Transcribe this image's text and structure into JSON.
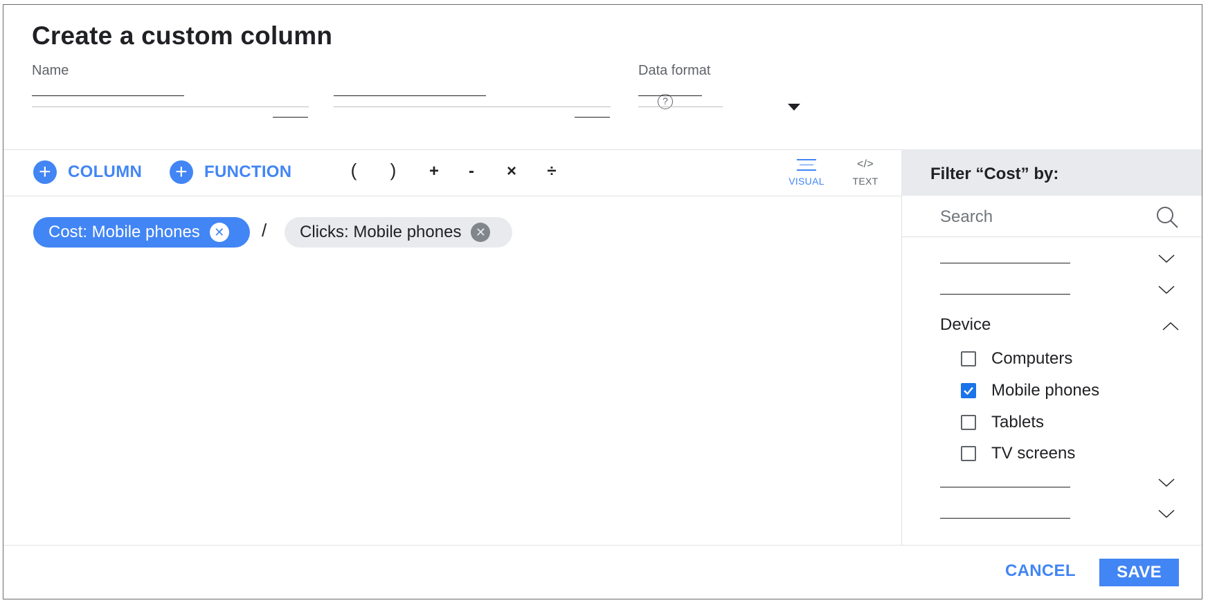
{
  "dialog": {
    "title": "Create a custom column"
  },
  "fields": {
    "name_label": "Name",
    "name_value": "",
    "formula_value": "",
    "data_format_label": "Data format",
    "data_format_value": ""
  },
  "toolbar": {
    "column_label": "COLUMN",
    "function_label": "FUNCTION",
    "operators": [
      "(",
      ")",
      "+",
      "-",
      "×",
      "÷"
    ],
    "modes": [
      {
        "label": "VISUAL",
        "icon": "lines-icon",
        "active": true
      },
      {
        "label": "TEXT",
        "icon": "code-icon",
        "active": false
      }
    ],
    "text_mode_glyph": "</>"
  },
  "formula": {
    "chips": [
      {
        "label": "Cost: Mobile phones",
        "style": "blue"
      },
      {
        "label": "Clicks: Mobile phones",
        "style": "grey"
      }
    ],
    "operator": "/"
  },
  "filter_panel": {
    "title": "Filter “Cost” by:",
    "search_placeholder": "Search",
    "expanded_group": "Device",
    "options": [
      {
        "label": "Computers",
        "checked": false
      },
      {
        "label": "Mobile phones",
        "checked": true
      },
      {
        "label": "Tablets",
        "checked": false
      },
      {
        "label": "TV screens",
        "checked": false
      }
    ]
  },
  "footer": {
    "cancel_label": "CANCEL",
    "save_label": "SAVE"
  },
  "colors": {
    "accent": "#4285f4",
    "checkbox_checked": "#1a73e8",
    "chip_grey": "#e8eaed",
    "panel_header": "#e8eaed"
  }
}
